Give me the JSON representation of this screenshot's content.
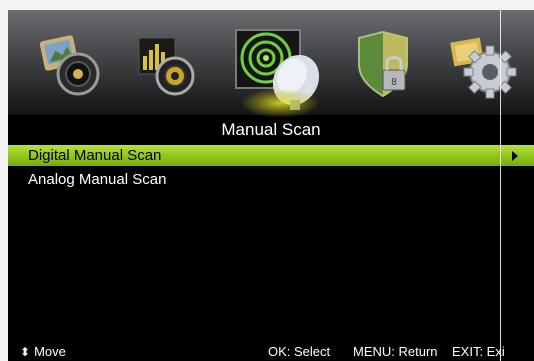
{
  "menu": {
    "title": "Manual Scan",
    "icons": [
      "picture-icon",
      "sound-icon",
      "channel-icon",
      "lock-icon",
      "setup-icon"
    ],
    "active_icon": "channel-icon",
    "items": [
      {
        "label": "Digital Manual Scan",
        "selected": true
      },
      {
        "label": "Analog Manual Scan",
        "selected": false
      }
    ],
    "selected_color": "#8fc41b"
  },
  "footer": {
    "move": "Move",
    "ok": "OK: Select",
    "menu": "MENU: Return",
    "exit": "EXIT: Exi"
  }
}
